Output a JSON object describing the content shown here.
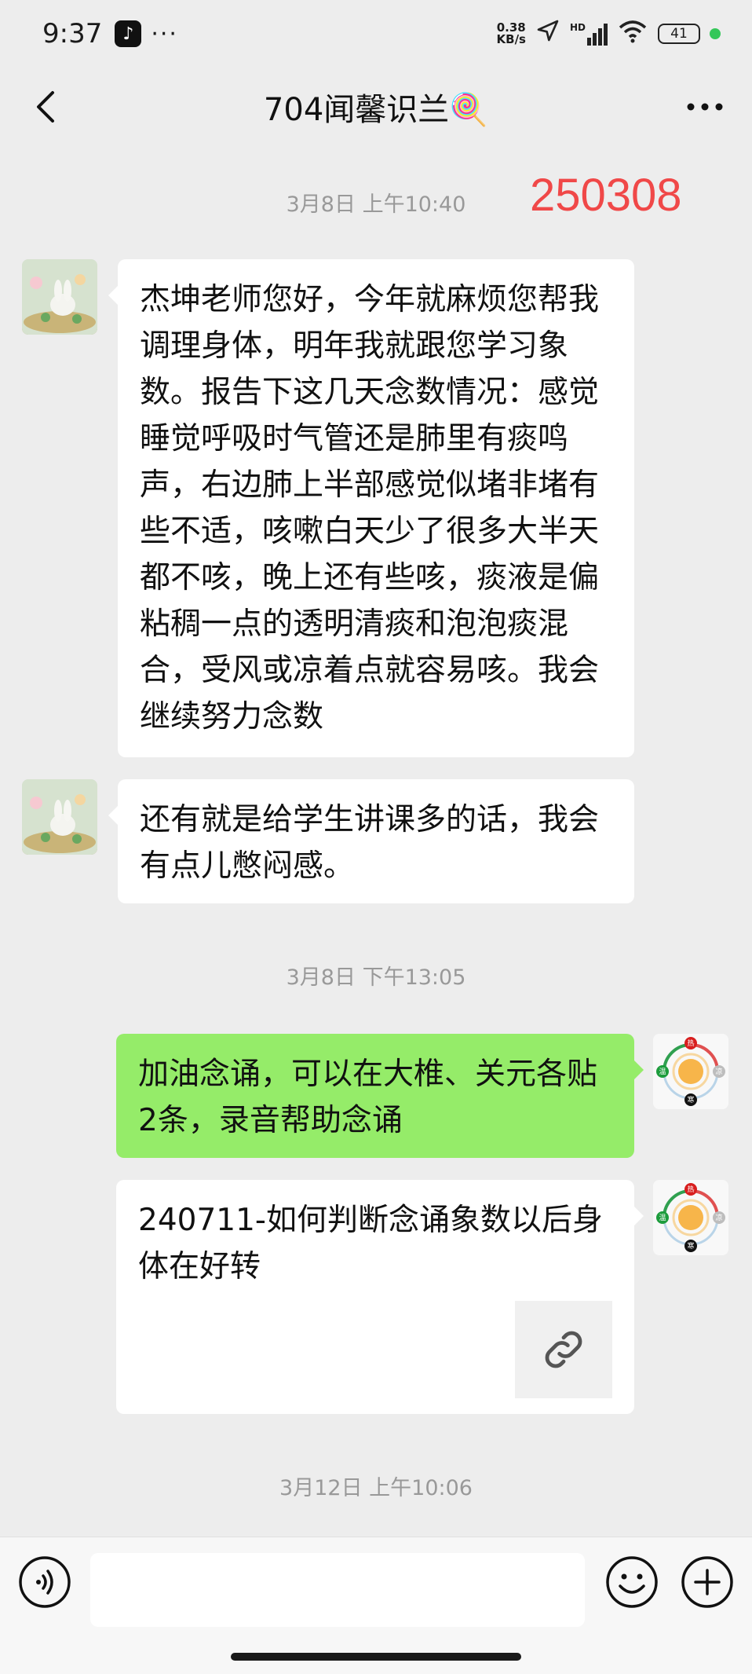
{
  "status_bar": {
    "time": "9:37",
    "dots": "···",
    "net_speed_value": "0.38",
    "net_speed_unit": "KB/s",
    "network": "HD",
    "battery": "41"
  },
  "nav": {
    "title": "704闻馨识兰🍭"
  },
  "stamp": "250308",
  "timestamps": [
    "3月8日 上午10:40",
    "3月8日 下午13:05",
    "3月12日 上午10:06"
  ],
  "messages": [
    {
      "side": "left",
      "text": "杰坤老师您好，今年就麻烦您帮我调理身体，明年我就跟您学习象数。报告下这几天念数情况：感觉睡觉呼吸时气管还是肺里有痰鸣声，右边肺上半部感觉似堵非堵有些不适，咳嗽白天少了很多大半天都不咳，晚上还有些咳，痰液是偏粘稠一点的透明清痰和泡泡痰混合，受风或凉着点就容易咳。我会继续努力念数"
    },
    {
      "side": "left",
      "text": "还有就是给学生讲课多的话，我会有点儿憋闷感。"
    },
    {
      "side": "right",
      "text": "加油念诵，可以在大椎、关元各贴2条，录音帮助念诵"
    },
    {
      "side": "right",
      "type": "link",
      "text": "240711-如何判断念诵象数以后身体在好转"
    }
  ],
  "avatar_right": {
    "labels": [
      "热",
      "温",
      "凉",
      "寒"
    ]
  },
  "colors": {
    "background": "#ededed",
    "bubble_white": "#ffffff",
    "bubble_green": "#95ec69",
    "stamp_red": "#f04848",
    "timestamp_gray": "#999999"
  },
  "icons": {
    "back": "chevron-left-icon",
    "more": "more-dots-icon",
    "voice": "voice-icon",
    "emoji": "emoji-icon",
    "plus": "plus-icon",
    "link": "link-icon"
  }
}
